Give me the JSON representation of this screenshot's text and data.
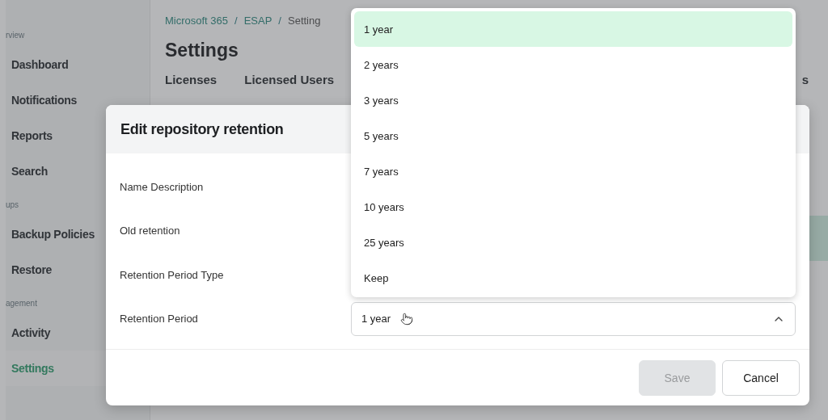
{
  "sidebar": {
    "sections": [
      {
        "label": "rview",
        "items": [
          {
            "label": "Dashboard",
            "selected": false
          },
          {
            "label": "Notifications",
            "selected": false
          },
          {
            "label": "Reports",
            "selected": false
          },
          {
            "label": "Search",
            "selected": false
          }
        ]
      },
      {
        "label": "ups",
        "items": [
          {
            "label": "Backup Policies",
            "selected": false
          },
          {
            "label": "Restore",
            "selected": false
          }
        ]
      },
      {
        "label": "agement",
        "items": [
          {
            "label": "Activity",
            "selected": false
          },
          {
            "label": "Settings",
            "selected": true
          }
        ]
      }
    ]
  },
  "breadcrumb": {
    "items": [
      "Microsoft 365",
      "ESAP",
      "Setting"
    ],
    "separator": "/"
  },
  "page_title": "Settings",
  "tabs": [
    {
      "label": "Licenses"
    },
    {
      "label": "Licensed Users"
    },
    {
      "label": "s"
    }
  ],
  "dialog": {
    "title": "Edit repository retention",
    "fields": [
      {
        "label": "Name Description"
      },
      {
        "label": "Old retention"
      },
      {
        "label": "Retention Period Type"
      },
      {
        "label": "Retention Period"
      }
    ],
    "select": {
      "value": "1 year",
      "expanded": true
    },
    "options": [
      {
        "label": "1 year",
        "selected": true
      },
      {
        "label": "2 years",
        "selected": false
      },
      {
        "label": "3 years",
        "selected": false
      },
      {
        "label": "5 years",
        "selected": false
      },
      {
        "label": "7 years",
        "selected": false
      },
      {
        "label": "10 years",
        "selected": false
      },
      {
        "label": "25 years",
        "selected": false
      },
      {
        "label": "Keep",
        "selected": false
      }
    ],
    "buttons": [
      {
        "label": "Save",
        "disabled": true
      },
      {
        "label": "Cancel",
        "disabled": false
      }
    ]
  }
}
